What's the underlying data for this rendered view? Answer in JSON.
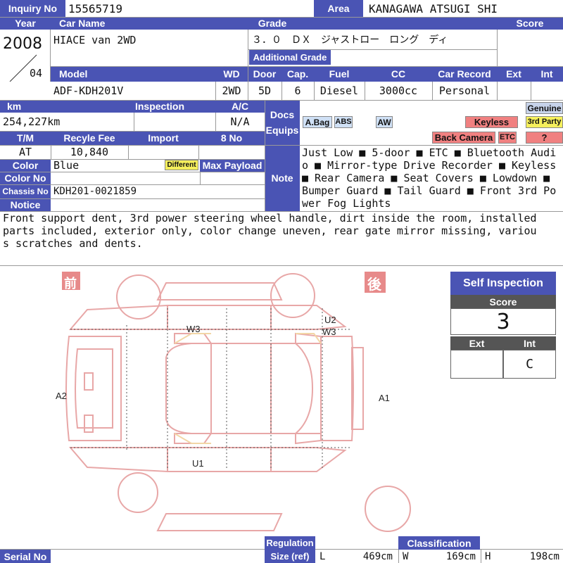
{
  "labels": {
    "inquiry_no": "Inquiry No",
    "area": "Area",
    "year": "Year",
    "car_name": "Car Name",
    "grade": "Grade",
    "score": "Score",
    "additional_grade": "Additional Grade",
    "model": "Model",
    "wd": "WD",
    "door": "Door",
    "cap": "Cap.",
    "fuel": "Fuel",
    "cc": "CC",
    "car_record": "Car Record",
    "ext": "Ext",
    "int": "Int",
    "km": "km",
    "inspection": "Inspection",
    "ac": "A/C",
    "docs": "Docs",
    "equips": "Equips",
    "tm": "T/M",
    "recycle_fee": "Recyle Fee",
    "import": "Import",
    "eight_no": "8 No",
    "color": "Color",
    "max_payload": "Max Payload",
    "color_no": "Color No",
    "note": "Note",
    "chassis_no": "Chassis No",
    "notice": "Notice",
    "regulation": "Regulation",
    "size_ref": "Size (ref)",
    "classification": "Classification",
    "serial_no": "Serial No",
    "l": "L",
    "w": "W",
    "h": "H"
  },
  "vehicle": {
    "inquiry_no": "15565719",
    "area": "KANAGAWA ATSUGI SHI",
    "year": "2008",
    "month": "04",
    "car_name": "HIACE van 2WD",
    "grade": "３．０　ＤＸ　ジャストロー　ロング　ディ",
    "model": "ADF-KDH201V",
    "wd": "2WD",
    "door": "5D",
    "cap": "6",
    "fuel": "Diesel",
    "cc": "3000cc",
    "car_record": "Personal",
    "km": "254,227km",
    "ac": "N/A",
    "tm": "AT",
    "recycle_fee": "10,840",
    "color": "Blue",
    "chassis_no": "KDH201-0021859",
    "length": "469cm",
    "width": "169cm",
    "height": "198cm"
  },
  "equips": {
    "abag": "A.Bag",
    "abs": "ABS",
    "aw": "AW",
    "keyless": "Keyless",
    "back_camera": "Back Camera",
    "etc": "ETC",
    "genuine": "Genuine",
    "third_party": "3rd Party",
    "question": "?",
    "different": "Different"
  },
  "note_text": "Just Low ■ 5-door ■ ETC ■ Bluetooth Audio ■ Mirror-type Drive Recorder ■ Keyless ■ Rear Camera ■ Seat Covers ■ Lowdown ■ Bumper Guard ■ Tail Guard ■ Front 3rd Power Fog Lights",
  "notice_text": "Front support dent, 3rd power steering wheel handle, dirt inside the room, installed parts included, exterior only, color change uneven, rear gate mirror missing, various scratches and dents.",
  "diagram": {
    "front": "前",
    "rear": "後",
    "marks": {
      "w3_front": "W3",
      "u2": "U2",
      "w3_rear": "W3",
      "a2": "A2",
      "a1": "A1",
      "u1": "U1"
    }
  },
  "self_inspection": {
    "title": "Self Inspection",
    "score_label": "Score",
    "score": "3",
    "ext_label": "Ext",
    "int_label": "Int",
    "ext": "",
    "int": "C"
  },
  "colors": {
    "header": "#4a54b4",
    "header_light": "#c7d3ea",
    "diagram_line": "#e8a7a7",
    "diagram_mark_bg": "#e78a8a",
    "badge_blue": "#cfe0f5",
    "badge_red": "#f08080",
    "badge_yellow": "#f5ef5c"
  }
}
